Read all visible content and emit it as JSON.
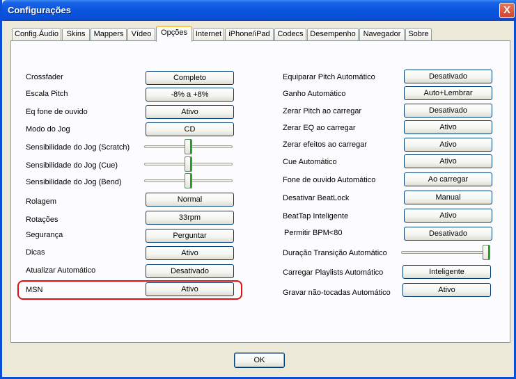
{
  "window": {
    "title": "Configurações",
    "close_label": "X"
  },
  "tabs": [
    {
      "label": "Config.Áudio"
    },
    {
      "label": "Skins"
    },
    {
      "label": "Mappers"
    },
    {
      "label": "Vídeo"
    },
    {
      "label": "Opções",
      "selected": true
    },
    {
      "label": "Internet"
    },
    {
      "label": "iPhone/iPad"
    },
    {
      "label": "Codecs"
    },
    {
      "label": "Desempenho"
    },
    {
      "label": "Navegador"
    },
    {
      "label": "Sobre"
    }
  ],
  "left": {
    "crossfader": {
      "label": "Crossfader",
      "value": "Completo"
    },
    "escala_pitch": {
      "label": "Escala Pitch",
      "value": "-8% a +8%"
    },
    "eq_fone": {
      "label": "Eq fone de ouvido",
      "value": "Ativo"
    },
    "modo_jog": {
      "label": "Modo do Jog",
      "value": "CD"
    },
    "sens_scratch": {
      "label": "Sensibilidade do Jog (Scratch)",
      "level": 0.5
    },
    "sens_cue": {
      "label": "Sensibilidade do Jog (Cue)",
      "level": 0.5
    },
    "sens_bend": {
      "label": "Sensibilidade do Jog (Bend)",
      "level": 0.5
    },
    "rolagem": {
      "label": "Rolagem",
      "value": "Normal"
    },
    "rotacoes": {
      "label": "Rotações",
      "value": "33rpm"
    },
    "seguranca": {
      "label": "Segurança",
      "value": "Perguntar"
    },
    "dicas": {
      "label": "Dicas",
      "value": "Ativo"
    },
    "atualizar": {
      "label": "Atualizar Automático",
      "value": "Desativado"
    },
    "msn": {
      "label": "MSN",
      "value": "Ativo"
    }
  },
  "right": {
    "equiparar_pitch": {
      "label": "Equiparar Pitch Automático",
      "value": "Desativado"
    },
    "ganho": {
      "label": "Ganho Automático",
      "value": "Auto+Lembrar"
    },
    "zerar_pitch": {
      "label": "Zerar Pitch ao carregar",
      "value": "Desativado"
    },
    "zerar_eq": {
      "label": "Zerar EQ ao carregar",
      "value": "Ativo"
    },
    "zerar_efeitos": {
      "label": "Zerar efeitos ao carregar",
      "value": "Ativo"
    },
    "cue_auto": {
      "label": "Cue Automático",
      "value": "Ativo"
    },
    "fone_auto": {
      "label": "Fone de ouvido Automático",
      "value": "Ao carregar"
    },
    "desativar_beatlock": {
      "label": "Desativar BeatLock",
      "value": "Manual"
    },
    "beattap": {
      "label": "BeatTap Inteligente",
      "value": "Ativo"
    },
    "permitir_bpm": {
      "label": "Permitir BPM<80",
      "value": "Desativado"
    },
    "duracao_transicao": {
      "label": "Duração Transição Automático",
      "level": 1.0
    },
    "carregar_playlists": {
      "label": "Carregar Playlists Automático",
      "value": "Inteligente"
    },
    "gravar_nao_tocadas": {
      "label": "Gravar não-tocadas Automático",
      "value": "Ativo"
    }
  },
  "footer": {
    "ok_label": "OK"
  },
  "colors": {
    "title_bar": "#0a55df",
    "dialog_bg": "#ece9d8",
    "panel_bg": "#fcfcfe",
    "active_tab_accent": "#ffc83c",
    "button_border": "#003c74",
    "highlight": "#e01010"
  }
}
